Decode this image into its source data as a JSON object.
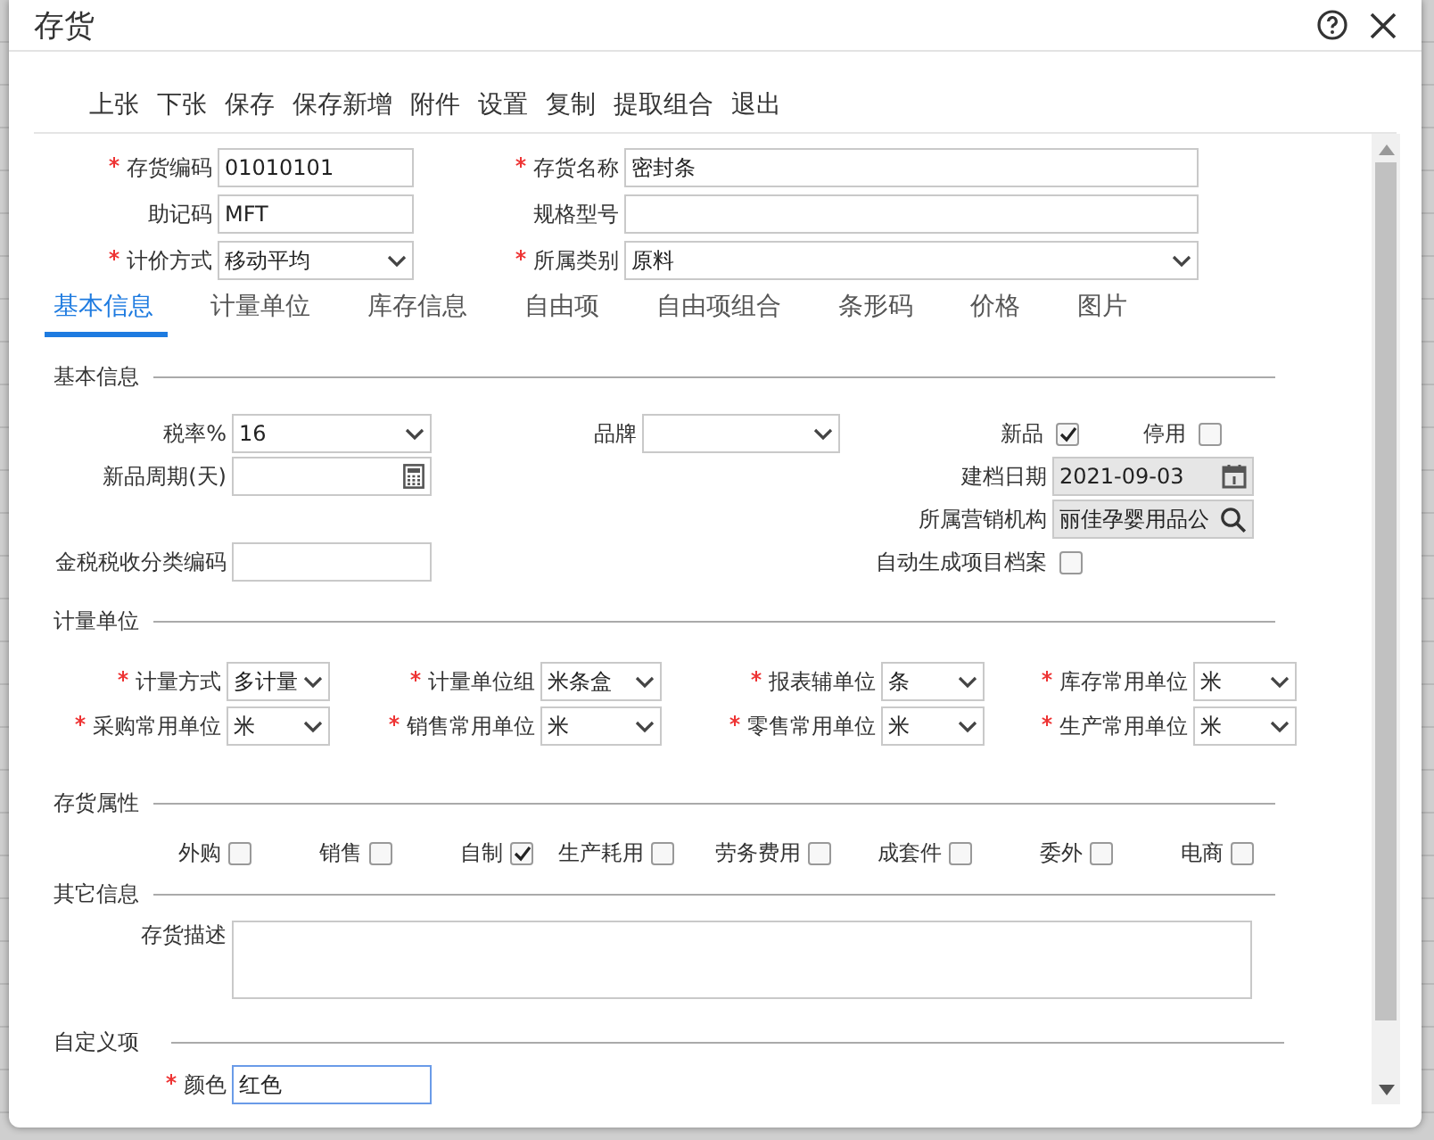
{
  "window": {
    "title": "存货"
  },
  "toolbar": [
    "上张",
    "下张",
    "保存",
    "保存新增",
    "附件",
    "设置",
    "复制",
    "提取组合",
    "退出"
  ],
  "header_fields": [
    {
      "label": "存货编码",
      "required": true,
      "kind": "input",
      "value": "01010101"
    },
    {
      "label": "存货名称",
      "required": true,
      "kind": "input",
      "value": "密封条"
    },
    {
      "label": "助记码",
      "required": false,
      "kind": "input",
      "value": "MFT"
    },
    {
      "label": "规格型号",
      "required": false,
      "kind": "input"
    },
    {
      "label": "计价方式",
      "required": true,
      "kind": "select",
      "value": "移动平均"
    },
    {
      "label": "所属类别",
      "required": true,
      "kind": "select",
      "value": "原料"
    }
  ],
  "tabs": [
    {
      "label": "基本信息",
      "selected": true
    },
    {
      "label": "计量单位",
      "selected": false
    },
    {
      "label": "库存信息",
      "selected": false
    },
    {
      "label": "自由项",
      "selected": false
    },
    {
      "label": "自由项组合",
      "selected": false
    },
    {
      "label": "条形码",
      "selected": false
    },
    {
      "label": "价格",
      "selected": false
    },
    {
      "label": "图片",
      "selected": false
    }
  ],
  "basic_info": {
    "title": "基本信息",
    "tax_rate": {
      "label": "税率%",
      "value": "16"
    },
    "brand": {
      "label": "品牌"
    },
    "new_item": {
      "label": "新品",
      "checked": true
    },
    "disabled": {
      "label": "停用",
      "checked": false
    },
    "new_period": {
      "label": "新品周期(天)"
    },
    "created_date": {
      "label": "建档日期",
      "value": "2021-09-03"
    },
    "sales_org": {
      "label": "所属营销机构",
      "value": "丽佳孕婴用品公"
    },
    "tax_code": {
      "label": "金税税收分类编码"
    },
    "auto_project": {
      "label": "自动生成项目档案",
      "checked": false
    }
  },
  "units": {
    "title": "计量单位",
    "fields": [
      {
        "label": "计量方式",
        "required": true,
        "value": "多计量"
      },
      {
        "label": "计量单位组",
        "required": true,
        "value": "米条盒"
      },
      {
        "label": "报表辅单位",
        "required": true,
        "value": "条"
      },
      {
        "label": "库存常用单位",
        "required": true,
        "value": "米"
      },
      {
        "label": "采购常用单位",
        "required": true,
        "value": "米"
      },
      {
        "label": "销售常用单位",
        "required": true,
        "value": "米"
      },
      {
        "label": "零售常用单位",
        "required": true,
        "value": "米"
      },
      {
        "label": "生产常用单位",
        "required": true,
        "value": "米"
      }
    ]
  },
  "attributes": {
    "title": "存货属性",
    "items": [
      {
        "label": "外购",
        "checked": false
      },
      {
        "label": "销售",
        "checked": false
      },
      {
        "label": "自制",
        "checked": true
      },
      {
        "label": "生产耗用",
        "checked": false
      },
      {
        "label": "劳务费用",
        "checked": false
      },
      {
        "label": "成套件",
        "checked": false
      },
      {
        "label": "委外",
        "checked": false
      },
      {
        "label": "电商",
        "checked": false
      }
    ]
  },
  "other": {
    "title": "其它信息",
    "description": {
      "label": "存货描述"
    }
  },
  "custom": {
    "title": "自定义项",
    "fields": [
      {
        "label": "颜色",
        "required": true,
        "value": "红色"
      }
    ]
  }
}
